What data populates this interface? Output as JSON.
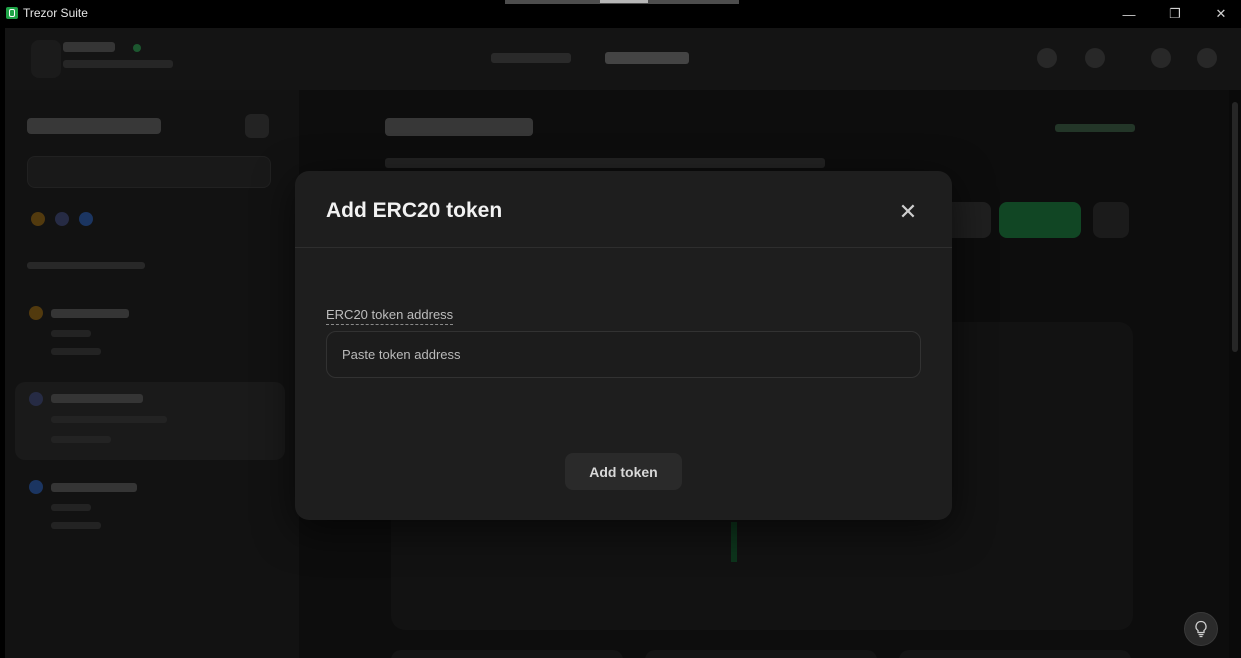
{
  "window": {
    "title": "Trezor Suite",
    "controls": {
      "minimize": "—",
      "maximize": "❐",
      "close": "✕"
    }
  },
  "modal": {
    "title": "Add ERC20 token",
    "close_icon": "✕",
    "field_label": "ERC20 token address",
    "field_placeholder": "Paste token address",
    "field_value": "",
    "submit_label": "Add token"
  },
  "colors": {
    "accent": "#1fa347",
    "modal_bg": "#1e1e1e",
    "app_bg": "#121212"
  }
}
